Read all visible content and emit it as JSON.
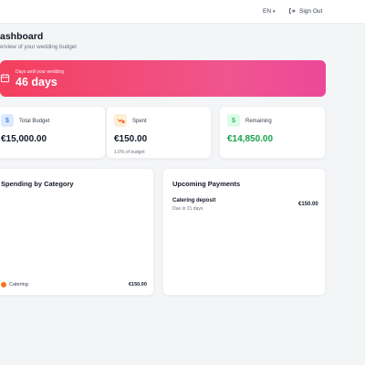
{
  "topbar": {
    "language": "EN",
    "signout_label": "Sign Out"
  },
  "page": {
    "title": "ashboard",
    "subtitle": "erview of your wedding budget"
  },
  "countdown": {
    "label": "Days until your wedding",
    "value": "46 days"
  },
  "stats": [
    {
      "label": "Total Budget",
      "value": "€15,000.00",
      "icon": "dollar-icon",
      "color": "#111827"
    },
    {
      "label": "Spent",
      "value": "€150.00",
      "sub": "1.0% of budget",
      "icon": "trend-down-icon",
      "color": "#111827"
    },
    {
      "label": "Remaining",
      "value": "€14,850.00",
      "icon": "dollar-icon",
      "color": "#16a34a"
    }
  ],
  "spending": {
    "title": "Spending by Category",
    "items": [
      {
        "name": "Catering",
        "amount": "€150.00",
        "color": "#f97316"
      }
    ]
  },
  "payments": {
    "title": "Upcoming Payments",
    "items": [
      {
        "name": "Catering deposit",
        "due": "Due in 21 days",
        "amount": "€150.00"
      }
    ]
  },
  "colors": {
    "hero_start": "#f43f5e",
    "hero_end": "#ec4899",
    "remaining": "#16a34a"
  }
}
